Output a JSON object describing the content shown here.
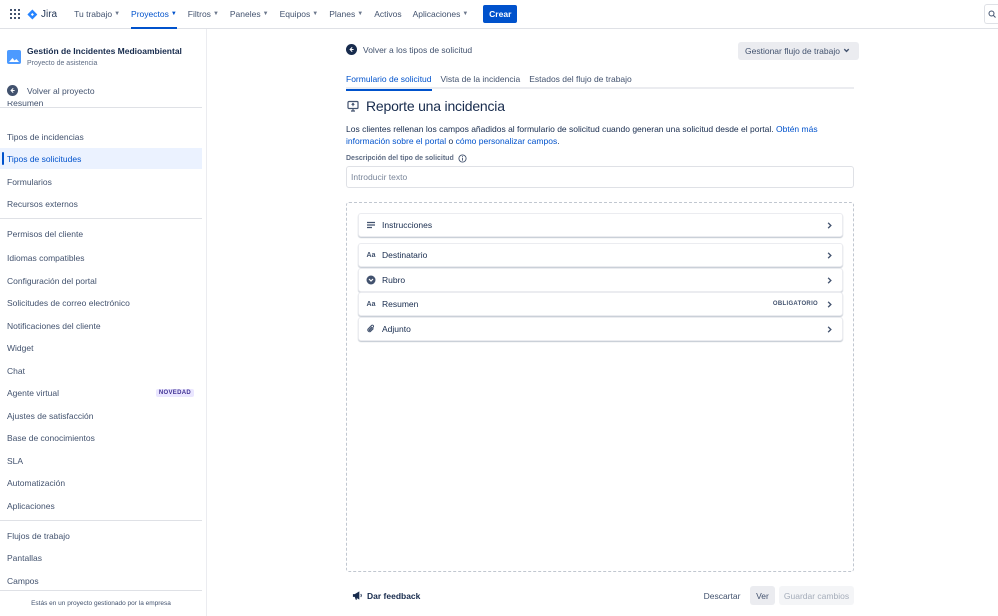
{
  "topnav": {
    "logo_text": "Jira",
    "items": [
      {
        "label": "Tu trabajo",
        "dropdown": true,
        "active": false
      },
      {
        "label": "Proyectos",
        "dropdown": true,
        "active": true
      },
      {
        "label": "Filtros",
        "dropdown": true,
        "active": false
      },
      {
        "label": "Paneles",
        "dropdown": true,
        "active": false
      },
      {
        "label": "Equipos",
        "dropdown": true,
        "active": false
      },
      {
        "label": "Planes",
        "dropdown": true,
        "active": false
      },
      {
        "label": "Activos",
        "dropdown": false,
        "active": false
      },
      {
        "label": "Aplicaciones",
        "dropdown": true,
        "active": false
      }
    ],
    "create_label": "Crear",
    "search_icon": "search-icon"
  },
  "sidebar": {
    "project_name": "Gestión de Incidentes Medioambiental",
    "project_type": "Proyecto de asistencia",
    "back_label": "Volver al proyecto",
    "cut_item": "Resumen",
    "items": [
      {
        "label": "Tipos de incidencias"
      },
      {
        "label": "Tipos de solicitudes",
        "active": true
      },
      {
        "label": "Formularios"
      },
      {
        "label": "Recursos externos"
      },
      {
        "label": "Permisos del cliente"
      },
      {
        "label": "Idiomas compatibles"
      },
      {
        "label": "Configuración del portal"
      },
      {
        "label": "Solicitudes de correo electrónico"
      },
      {
        "label": "Notificaciones del cliente"
      },
      {
        "label": "Widget"
      },
      {
        "label": "Chat"
      },
      {
        "label": "Agente virtual",
        "badge": "NOVEDAD"
      },
      {
        "label": "Ajustes de satisfacción"
      },
      {
        "label": "Base de conocimientos"
      },
      {
        "label": "SLA"
      },
      {
        "label": "Automatización"
      },
      {
        "label": "Aplicaciones"
      },
      {
        "label": "Flujos de trabajo"
      },
      {
        "label": "Pantallas"
      },
      {
        "label": "Campos"
      }
    ],
    "footer": "Estás en un proyecto gestionado por la empresa"
  },
  "main": {
    "back_label": "Volver a los tipos de solicitud",
    "manage_workflow": "Gestionar flujo de trabajo",
    "tabs": [
      {
        "label": "Formulario de solicitud",
        "active": true
      },
      {
        "label": "Vista de la incidencia",
        "active": false
      },
      {
        "label": "Estados del flujo de trabajo",
        "active": false
      }
    ],
    "title": "Reporte una incidencia",
    "description_text": "Los clientes rellenan los campos añadidos al formulario de solicitud cuando generan una solicitud desde el portal. ",
    "description_link1": "Obtén más información sobre el portal",
    "description_or": " o ",
    "description_link2": "cómo personalizar campos",
    "description_end": ".",
    "field_label": "Descripción del tipo de solicitud",
    "field_placeholder": "Introducir texto",
    "fields": [
      {
        "label": "Instrucciones",
        "icon": "text-lines-icon"
      },
      {
        "label": "Destinatario",
        "icon": "text-field-icon"
      },
      {
        "label": "Rubro",
        "icon": "select-dropdown-icon"
      },
      {
        "label": "Resumen",
        "icon": "text-field-icon",
        "badge": "OBLIGATORIO"
      },
      {
        "label": "Adjunto",
        "icon": "attachment-icon"
      }
    ],
    "feedback_label": "Dar feedback",
    "discard_label": "Descartar",
    "view_label": "Ver",
    "save_label": "Guardar cambios"
  }
}
